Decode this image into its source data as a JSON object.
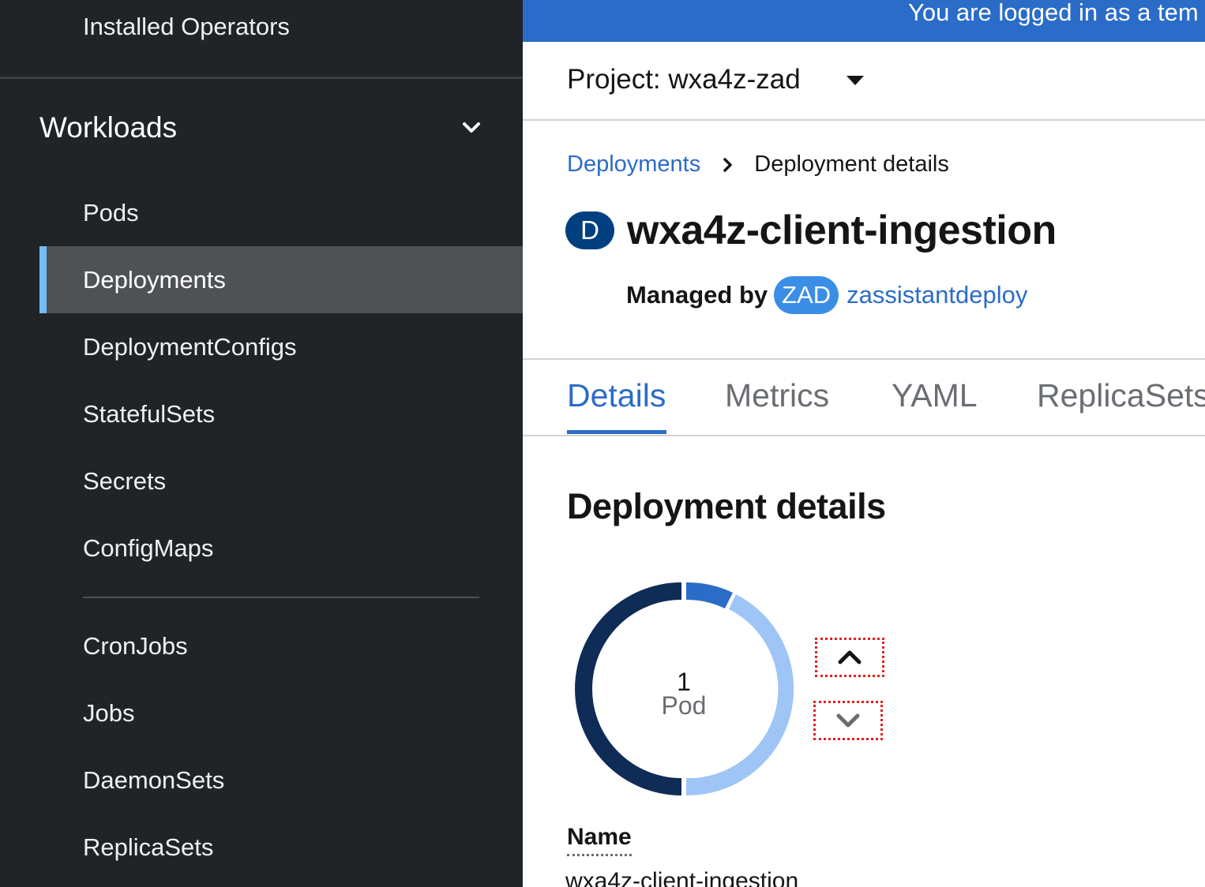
{
  "sidebar": {
    "top_item": "Installed Operators",
    "section_label": "Workloads",
    "items": [
      {
        "label": "Pods",
        "active": false
      },
      {
        "label": "Deployments",
        "active": true
      },
      {
        "label": "DeploymentConfigs",
        "active": false
      },
      {
        "label": "StatefulSets",
        "active": false
      },
      {
        "label": "Secrets",
        "active": false
      },
      {
        "label": "ConfigMaps",
        "active": false
      },
      {
        "label": "CronJobs",
        "active": false
      },
      {
        "label": "Jobs",
        "active": false
      },
      {
        "label": "DaemonSets",
        "active": false
      },
      {
        "label": "ReplicaSets",
        "active": false
      }
    ]
  },
  "banner": {
    "text": "You are logged in as a tem"
  },
  "project": {
    "label": "Project: wxa4z-zad"
  },
  "breadcrumb": {
    "parent": "Deployments",
    "current": "Deployment details"
  },
  "resource": {
    "badge": "D",
    "name": "wxa4z-client-ingestion",
    "managed_by_label": "Managed by",
    "operator_badge": "ZAD",
    "operator_name": "zassistantdeploy"
  },
  "tabs": [
    {
      "label": "Details",
      "active": true
    },
    {
      "label": "Metrics",
      "active": false
    },
    {
      "label": "YAML",
      "active": false
    },
    {
      "label": "ReplicaSets",
      "active": false
    }
  ],
  "details": {
    "section_title": "Deployment details",
    "pod_count": "1",
    "pod_unit": "Pod",
    "name_label": "Name",
    "name_value": "wxa4z-client-ingestion"
  },
  "colors": {
    "accent": "#2b6cc8",
    "sidebar_bg": "#212427",
    "donut_dark": "#0f2c57",
    "donut_mid": "#2b6cc8",
    "donut_light": "#9ec5f5"
  }
}
